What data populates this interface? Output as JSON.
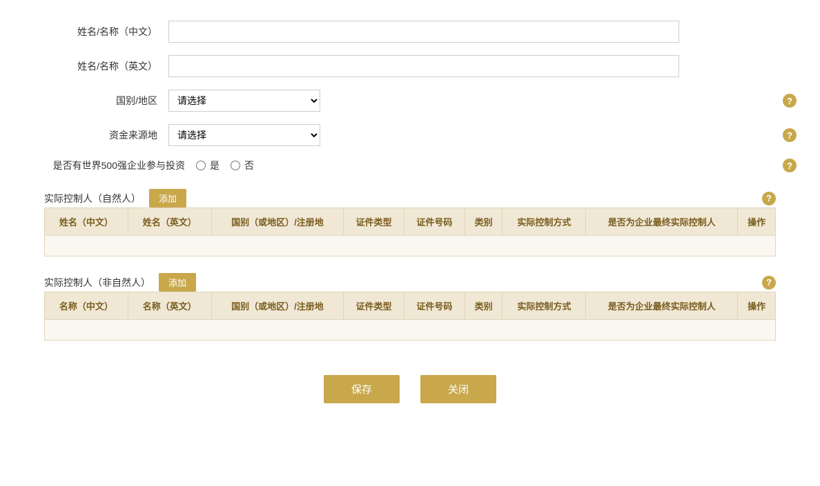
{
  "form": {
    "name_cn_label": "姓名/名称（中文）",
    "name_en_label": "姓名/名称（英文）",
    "country_label": "国别/地区",
    "fund_source_label": "资金来源地",
    "fortune500_label": "是否有世界500强企业参与投资",
    "country_placeholder": "请选择",
    "fund_placeholder": "请选择",
    "radio_yes": "是",
    "radio_no": "否",
    "name_cn_value": "",
    "name_en_value": ""
  },
  "natural_person": {
    "title": "实际控制人（自然人）",
    "add_label": "添加",
    "help": "?",
    "columns": [
      "姓名（中文）",
      "姓名（英文）",
      "国别（或地区）/注册地",
      "证件类型",
      "证件号码",
      "类别",
      "实际控制方式",
      "是否为企业最终实际控制人",
      "操作"
    ]
  },
  "non_natural_person": {
    "title": "实际控制人（非自然人）",
    "add_label": "添加",
    "help": "?",
    "columns": [
      "名称（中文）",
      "名称（英文）",
      "国别（或地区）/注册地",
      "证件类型",
      "证件号码",
      "类别",
      "实际控制方式",
      "是否为企业最终实际控制人",
      "操作"
    ]
  },
  "buttons": {
    "save": "保存",
    "close": "关闭"
  },
  "help_icon": "?"
}
